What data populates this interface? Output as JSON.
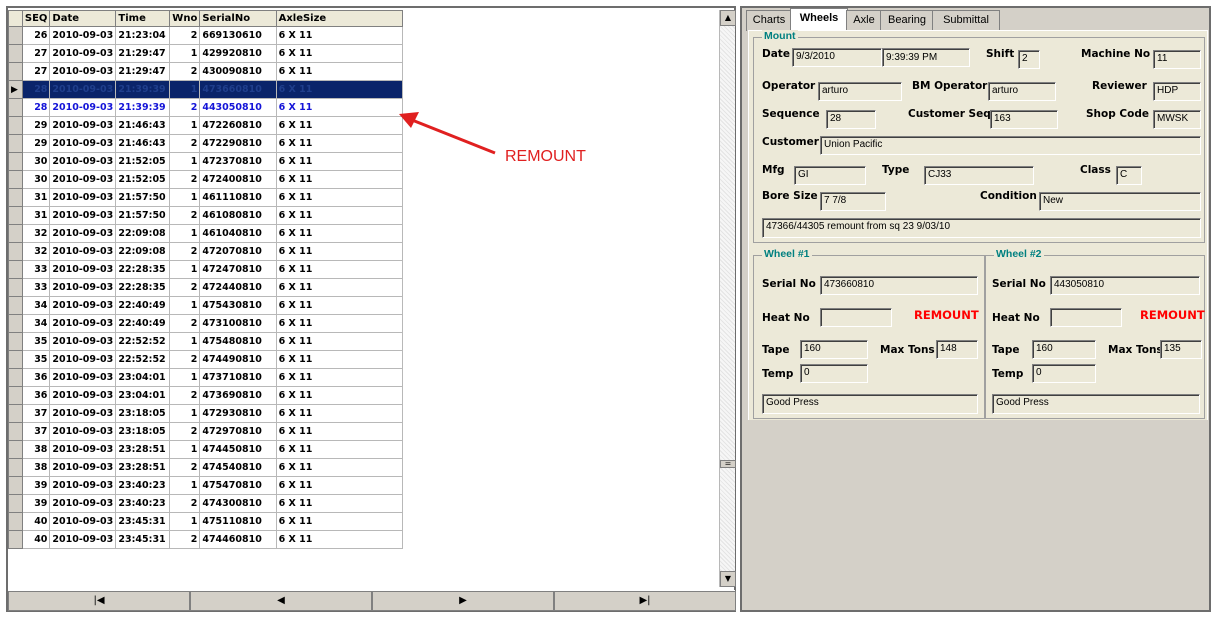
{
  "grid": {
    "columns": [
      "SEQ",
      "Date",
      "Time",
      "Wno",
      "SerialNo",
      "AxleSize"
    ],
    "rows": [
      [
        "26",
        "2010-09-03",
        "21:23:04",
        "2",
        "669130610",
        "6 X 11"
      ],
      [
        "27",
        "2010-09-03",
        "21:29:47",
        "1",
        "429920810",
        "6 X 11"
      ],
      [
        "27",
        "2010-09-03",
        "21:29:47",
        "2",
        "430090810",
        "6 X 11"
      ],
      [
        "28",
        "2010-09-03",
        "21:39:39",
        "1",
        "473660810",
        "6 X 11"
      ],
      [
        "28",
        "2010-09-03",
        "21:39:39",
        "2",
        "443050810",
        "6 X 11"
      ],
      [
        "29",
        "2010-09-03",
        "21:46:43",
        "1",
        "472260810",
        "6 X 11"
      ],
      [
        "29",
        "2010-09-03",
        "21:46:43",
        "2",
        "472290810",
        "6 X 11"
      ],
      [
        "30",
        "2010-09-03",
        "21:52:05",
        "1",
        "472370810",
        "6 X 11"
      ],
      [
        "30",
        "2010-09-03",
        "21:52:05",
        "2",
        "472400810",
        "6 X 11"
      ],
      [
        "31",
        "2010-09-03",
        "21:57:50",
        "1",
        "461110810",
        "6 X 11"
      ],
      [
        "31",
        "2010-09-03",
        "21:57:50",
        "2",
        "461080810",
        "6 X 11"
      ],
      [
        "32",
        "2010-09-03",
        "22:09:08",
        "1",
        "461040810",
        "6 X 11"
      ],
      [
        "32",
        "2010-09-03",
        "22:09:08",
        "2",
        "472070810",
        "6 X 11"
      ],
      [
        "33",
        "2010-09-03",
        "22:28:35",
        "1",
        "472470810",
        "6 X 11"
      ],
      [
        "33",
        "2010-09-03",
        "22:28:35",
        "2",
        "472440810",
        "6 X 11"
      ],
      [
        "34",
        "2010-09-03",
        "22:40:49",
        "1",
        "475430810",
        "6 X 11"
      ],
      [
        "34",
        "2010-09-03",
        "22:40:49",
        "2",
        "473100810",
        "6 X 11"
      ],
      [
        "35",
        "2010-09-03",
        "22:52:52",
        "1",
        "475480810",
        "6 X 11"
      ],
      [
        "35",
        "2010-09-03",
        "22:52:52",
        "2",
        "474490810",
        "6 X 11"
      ],
      [
        "36",
        "2010-09-03",
        "23:04:01",
        "1",
        "473710810",
        "6 X 11"
      ],
      [
        "36",
        "2010-09-03",
        "23:04:01",
        "2",
        "473690810",
        "6 X 11"
      ],
      [
        "37",
        "2010-09-03",
        "23:18:05",
        "1",
        "472930810",
        "6 X 11"
      ],
      [
        "37",
        "2010-09-03",
        "23:18:05",
        "2",
        "472970810",
        "6 X 11"
      ],
      [
        "38",
        "2010-09-03",
        "23:28:51",
        "1",
        "474450810",
        "6 X 11"
      ],
      [
        "38",
        "2010-09-03",
        "23:28:51",
        "2",
        "474540810",
        "6 X 11"
      ],
      [
        "39",
        "2010-09-03",
        "23:40:23",
        "1",
        "475470810",
        "6 X 11"
      ],
      [
        "39",
        "2010-09-03",
        "23:40:23",
        "2",
        "474300810",
        "6 X 11"
      ],
      [
        "40",
        "2010-09-03",
        "23:45:31",
        "1",
        "475110810",
        "6 X 11"
      ],
      [
        "40",
        "2010-09-03",
        "23:45:31",
        "2",
        "474460810",
        "6 X 11"
      ]
    ],
    "selected_row_index": 3,
    "highlight_row_index": 4,
    "current_row_marker": "▶"
  },
  "nav": {
    "first": "|◀",
    "prev": "◀",
    "next": "▶",
    "last": "▶|"
  },
  "annotation": {
    "text": "REMOUNT",
    "color": "#e02020"
  },
  "tabs": [
    {
      "label": "Charts",
      "active": false
    },
    {
      "label": "Wheels",
      "active": true
    },
    {
      "label": "Axle",
      "active": false
    },
    {
      "label": "Bearing",
      "active": false
    },
    {
      "label": "Submittal",
      "active": false
    }
  ],
  "mount": {
    "title": "Mount",
    "date_label": "Date",
    "date_value": "9/3/2010",
    "time_value": "9:39:39 PM",
    "shift_label": "Shift",
    "shift_value": "2",
    "machine_label": "Machine No",
    "machine_value": "11",
    "operator_label": "Operator",
    "operator_value": "arturo",
    "bm_operator_label": "BM Operator",
    "bm_operator_value": "arturo",
    "reviewer_label": "Reviewer",
    "reviewer_value": "HDP",
    "sequence_label": "Sequence",
    "sequence_value": "28",
    "customer_seq_label": "Customer Seq",
    "customer_seq_value": "163",
    "shop_code_label": "Shop Code",
    "shop_code_value": "MWSK",
    "customer_label": "Customer",
    "customer_value": "Union Pacific",
    "mfg_label": "Mfg",
    "mfg_value": "GI",
    "type_label": "Type",
    "type_value": "CJ33",
    "class_label": "Class",
    "class_value": "C",
    "bore_label": "Bore Size",
    "bore_value": "7 7/8",
    "condition_label": "Condition",
    "condition_value": "New",
    "note": "47366/44305 remount from sq 23 9/03/10"
  },
  "wheel1": {
    "title": "Wheel #1",
    "serial_label": "Serial No",
    "serial_value": "473660810",
    "heat_label": "Heat No",
    "heat_value": "",
    "status": "REMOUNT",
    "tape_label": "Tape",
    "tape_value": "160",
    "max_tons_label": "Max Tons",
    "max_tons_value": "148",
    "temp_label": "Temp",
    "temp_value": "0",
    "remark": "Good Press"
  },
  "wheel2": {
    "title": "Wheel #2",
    "serial_label": "Serial No",
    "serial_value": "443050810",
    "heat_label": "Heat No",
    "heat_value": "",
    "status": "REMOUNT",
    "tape_label": "Tape",
    "tape_value": "160",
    "max_tons_label": "Max Tons",
    "max_tons_value": "135",
    "temp_label": "Temp",
    "temp_value": "0",
    "remark": "Good Press"
  }
}
